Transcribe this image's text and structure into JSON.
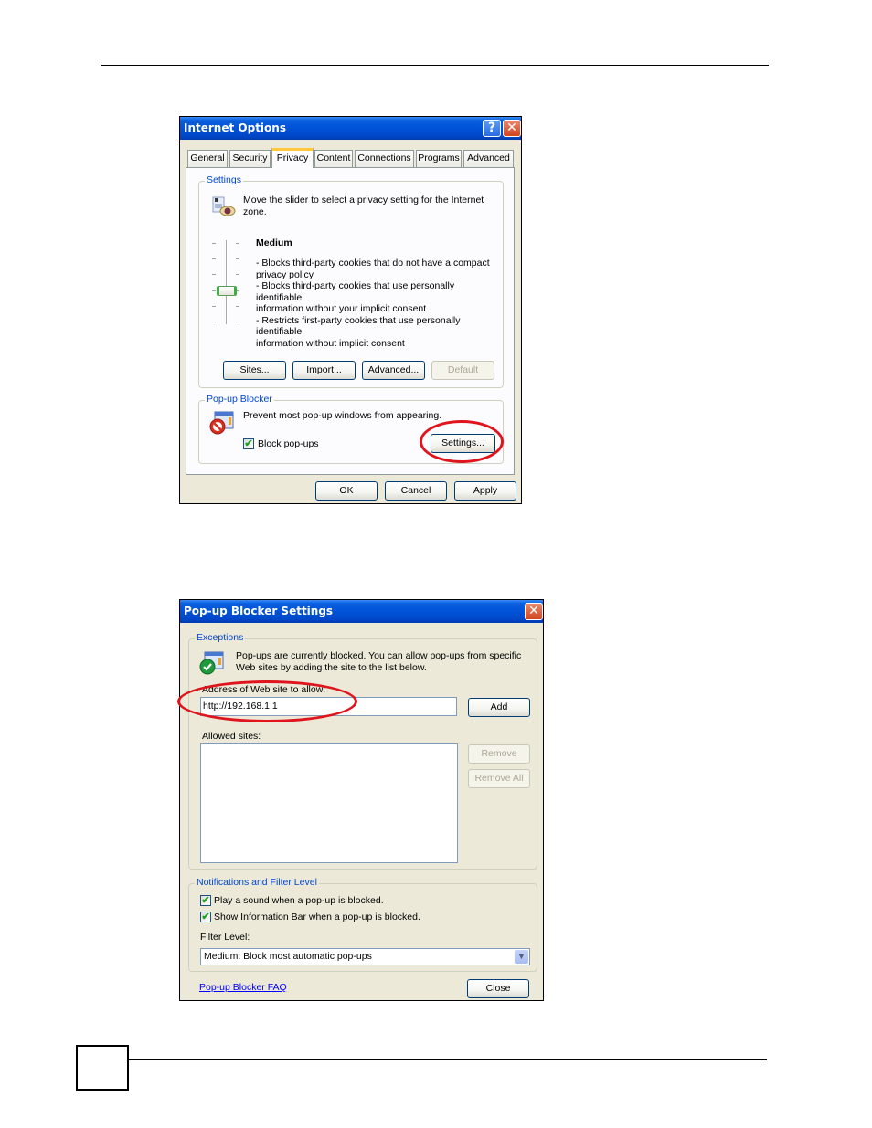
{
  "dialog1": {
    "title": "Internet Options",
    "help_glyph": "?",
    "close_glyph": "✕",
    "tabs": [
      {
        "label": "General",
        "active": false
      },
      {
        "label": "Security",
        "active": false
      },
      {
        "label": "Privacy",
        "active": true
      },
      {
        "label": "Content",
        "active": false
      },
      {
        "label": "Connections",
        "active": false
      },
      {
        "label": "Programs",
        "active": false
      },
      {
        "label": "Advanced",
        "active": false
      }
    ],
    "settings": {
      "group_label": "Settings",
      "icon": "privacy-eye-icon",
      "intro_line1": "Move the slider to select a privacy setting for the Internet",
      "intro_line2": "zone.",
      "level_title": "Medium",
      "slider": {
        "positions": 6,
        "selected_index_from_top": 3
      },
      "description_lines": [
        "- Blocks third-party cookies that do not have a compact",
        "privacy policy",
        "- Blocks third-party cookies that use personally identifiable",
        "information without your implicit consent",
        "- Restricts first-party cookies that use personally identifiable",
        "information without implicit consent"
      ],
      "buttons": {
        "sites": "Sites...",
        "import": "Import...",
        "advanced": "Advanced...",
        "default": "Default"
      }
    },
    "popup_blocker": {
      "group_label": "Pop-up Blocker",
      "icon": "popup-blocked-icon",
      "description": "Prevent most pop-up windows from appearing.",
      "block_checkbox_label": "Block pop-ups",
      "block_checked": true,
      "settings_button": "Settings..."
    },
    "footer": {
      "ok": "OK",
      "cancel": "Cancel",
      "apply": "Apply"
    }
  },
  "dialog2": {
    "title": "Pop-up Blocker Settings",
    "close_glyph": "✕",
    "exceptions": {
      "group_label": "Exceptions",
      "icon": "popup-allowed-icon",
      "info_line1": "Pop-ups are currently blocked.  You can allow pop-ups from specific",
      "info_line2": "Web sites by adding the site to the list below.",
      "address_label": "Address of Web site to allow:",
      "address_value": "http://192.168.1.1",
      "add_button": "Add",
      "allowed_label": "Allowed sites:",
      "allowed_sites": [],
      "remove_button": "Remove",
      "remove_all_button": "Remove All"
    },
    "notifications": {
      "group_label": "Notifications and Filter Level",
      "play_sound_label": "Play a sound when a pop-up is blocked.",
      "play_sound_checked": true,
      "show_bar_label": "Show Information Bar when a pop-up is blocked.",
      "show_bar_checked": true,
      "filter_label": "Filter Level:",
      "filter_value": "Medium: Block most automatic pop-ups"
    },
    "faq_link": "Pop-up Blocker FAQ",
    "close_button": "Close"
  },
  "checkmark_glyph": "✔",
  "dropdown_glyph": "▼",
  "highlight_color": "#e0141c"
}
